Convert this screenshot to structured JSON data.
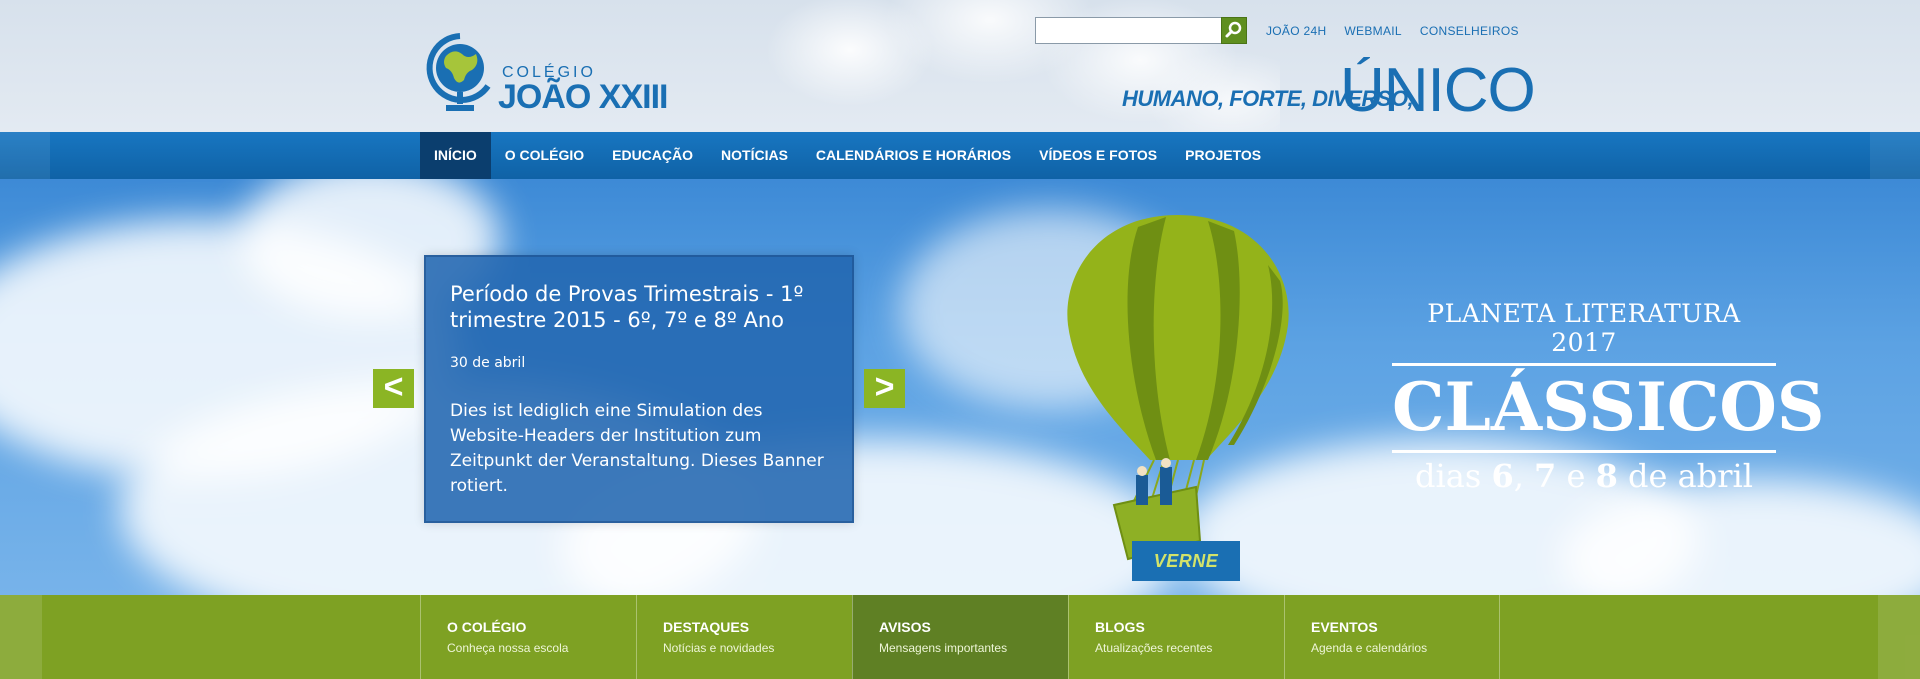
{
  "header": {
    "logo_small": "COLÉGIO",
    "logo_big": "JOÃO XXIII",
    "search": {
      "value": "",
      "placeholder": ""
    },
    "top_links": [
      "JOÃO 24H",
      "WEBMAIL",
      "CONSELHEIROS"
    ],
    "slogan_small": "HUMANO, FORTE, DIVERSO,",
    "slogan_big": "ÚNICO"
  },
  "nav": {
    "items": [
      {
        "label": "INÍCIO"
      },
      {
        "label": "O COLÉGIO"
      },
      {
        "label": "EDUCAÇÃO"
      },
      {
        "label": "NOTÍCIAS"
      },
      {
        "label": "CALENDÁRIOS E HORÁRIOS"
      },
      {
        "label": "VÍDEOS E FOTOS"
      },
      {
        "label": "PROJETOS"
      }
    ],
    "active": "INÍCIO"
  },
  "hero": {
    "card": {
      "title": "Período de Provas Trimestrais - 1º trimestre 2015 - 6º, 7º e 8º Ano",
      "date": "30 de abril",
      "body": "Dies ist lediglich eine Simulation des Website-Headers der Institution zum Zeitpunkt der Veranstaltung. Dieses Banner rotiert."
    },
    "prev": "<",
    "next": ">",
    "badge": "VERNE",
    "banner": {
      "top": "PLANETA LITERATURA 2017",
      "middle": "CLÁSSICOS",
      "bottom_pre": "dias ",
      "d1": "6",
      "sep1": ", ",
      "d2": "7",
      "sep2": " e ",
      "d3": "8",
      "bottom_post": " de abril"
    }
  },
  "tiles": [
    {
      "title": "O Colégio",
      "sub": "Conheça nossa escola"
    },
    {
      "title": "Destaques",
      "sub": "Notícias e novidades"
    },
    {
      "title": "Avisos",
      "sub": "Mensagens importantes"
    },
    {
      "title": "Blogs",
      "sub": "Atualizações recentes"
    },
    {
      "title": "Eventos",
      "sub": "Agenda e calendários"
    }
  ],
  "colors": {
    "brand_blue": "#1a6fb3",
    "nav_active": "#0b3e6e",
    "green": "#7ea123",
    "arrow_green": "#8bb524"
  },
  "icons": [
    "globe-logo-icon",
    "search-icon",
    "balloon-illustration"
  ]
}
